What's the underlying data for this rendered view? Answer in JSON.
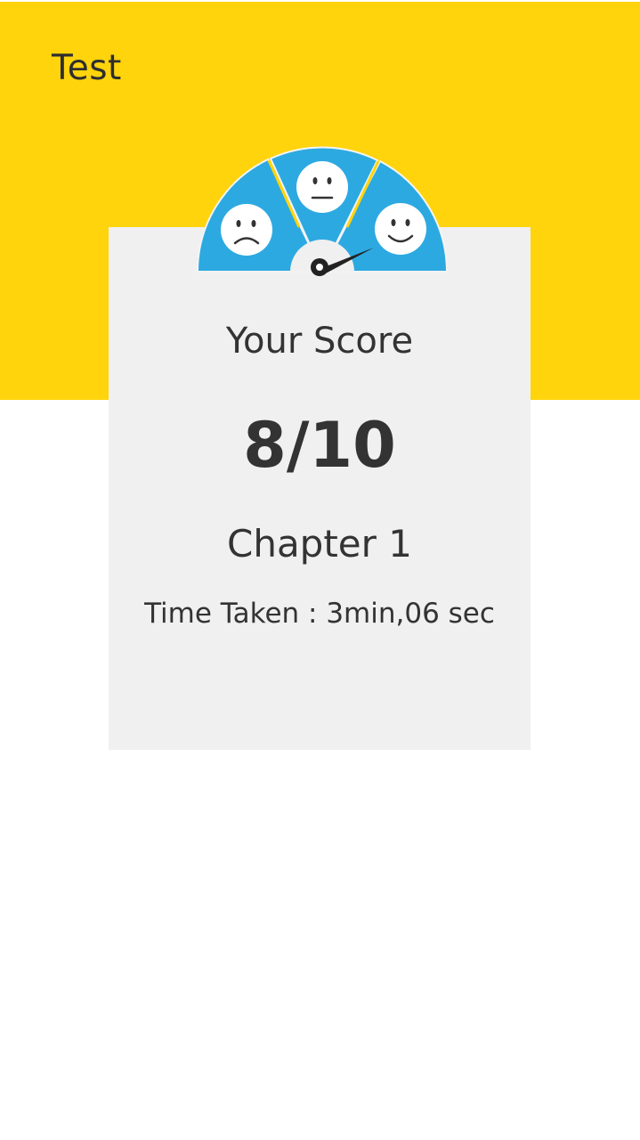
{
  "header": {
    "title": "Test"
  },
  "score_card": {
    "score_label": "Your Score",
    "score_value": "8/10",
    "chapter": "Chapter 1",
    "time_taken": "Time Taken : 3min,06 sec"
  },
  "meter": {
    "faces": [
      "sad-face-icon",
      "neutral-face-icon",
      "happy-face-icon"
    ],
    "needle_points_to": "happy"
  },
  "colors": {
    "header_background": "#FFD40C",
    "card_background": "#F0F0F0",
    "meter_fill": "#2DA9E1",
    "text": "#333333"
  }
}
